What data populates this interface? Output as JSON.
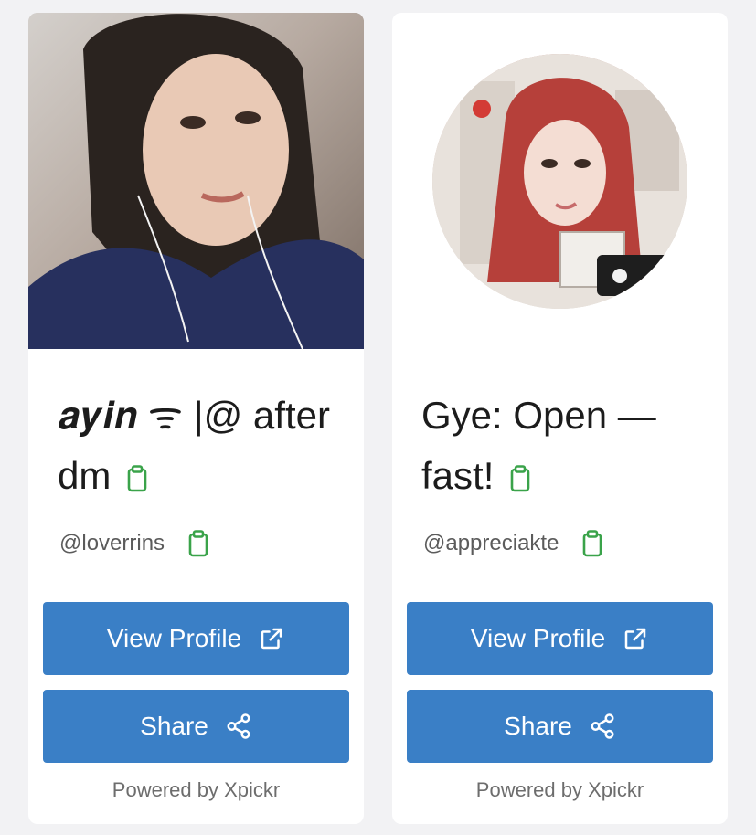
{
  "cards": [
    {
      "title": "𝒂𝒚𝒊𝒏 ᯤ |@ after dm",
      "handle": "@loverrins",
      "view_profile_label": "View Profile",
      "share_label": "Share",
      "powered_by": "Powered by Xpickr"
    },
    {
      "title": "Gye: Open — fast!",
      "handle": "@appreciakte",
      "view_profile_label": "View Profile",
      "share_label": "Share",
      "powered_by": "Powered by Xpickr"
    }
  ],
  "colors": {
    "button": "#3a7fc6",
    "clipboard_icon": "#3aa34a"
  },
  "icons": [
    "clipboard-icon",
    "external-link-icon",
    "share-icon"
  ]
}
